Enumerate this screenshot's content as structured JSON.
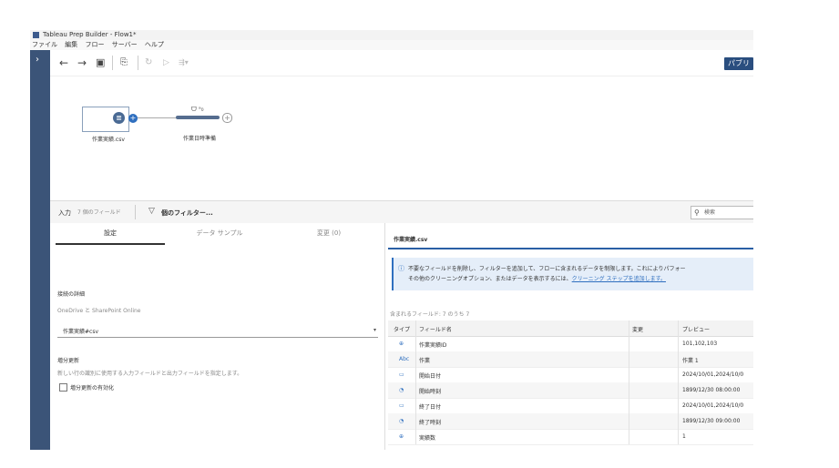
{
  "window": {
    "title": "Tableau Prep Builder - Flow1*"
  },
  "menu": [
    "ファイル",
    "編集",
    "フロー",
    "サーバー",
    "ヘルプ"
  ],
  "toolbar": {
    "publish_label": "パブリ"
  },
  "flow": {
    "node1_label": "作業実績.csv",
    "node2_label": "作業日時準備",
    "node2_icon": "ᗜ ᵃ₀"
  },
  "input_bar": {
    "title": "入力",
    "fields": "7 個のフィールド",
    "filter": "個のフィルター...",
    "search_placeholder": "検索"
  },
  "left_panel": {
    "tabs": [
      "設定",
      "データ サンプル",
      "変更 (0)"
    ],
    "connection_title": "接続の詳細",
    "connection_sub": "OneDrive と SharePoint Online",
    "file_value": "作業実績#csv",
    "incremental_title": "増分更新",
    "incremental_desc": "新しい行の識別に使用する入力フィールドと出力フィールドを指定します。",
    "incremental_checkbox": "増分更新の有効化"
  },
  "right_panel": {
    "file_title": "作業実績.csv",
    "info_line1": "不要なフィールドを削除し、フィルターを追加して、フローに含まれるデータを制限します。これによりパフォー",
    "info_line2": "その他のクリーニングオプション、またはデータを表示するには、",
    "info_link": "クリーニング ステップを追加します。",
    "included": "含まれるフィールド: 7 のうち 7",
    "headers": [
      "タイプ",
      "フィールド名",
      "変更",
      "プレビュー"
    ],
    "rows": [
      {
        "type": "⊕",
        "name": "作業実績ID",
        "preview": "101,102,103"
      },
      {
        "type": "Abc",
        "name": "作業",
        "preview": "作業 1"
      },
      {
        "type": "▭",
        "name": "開始日付",
        "preview": "2024/10/01,2024/10/0"
      },
      {
        "type": "◔",
        "name": "開始時刻",
        "preview": "1899/12/30 08:00:00"
      },
      {
        "type": "▭",
        "name": "終了日付",
        "preview": "2024/10/01,2024/10/0"
      },
      {
        "type": "◔",
        "name": "終了時刻",
        "preview": "1899/12/30 09:00:00"
      },
      {
        "type": "⊕",
        "name": "実績数",
        "preview": "1"
      }
    ]
  }
}
